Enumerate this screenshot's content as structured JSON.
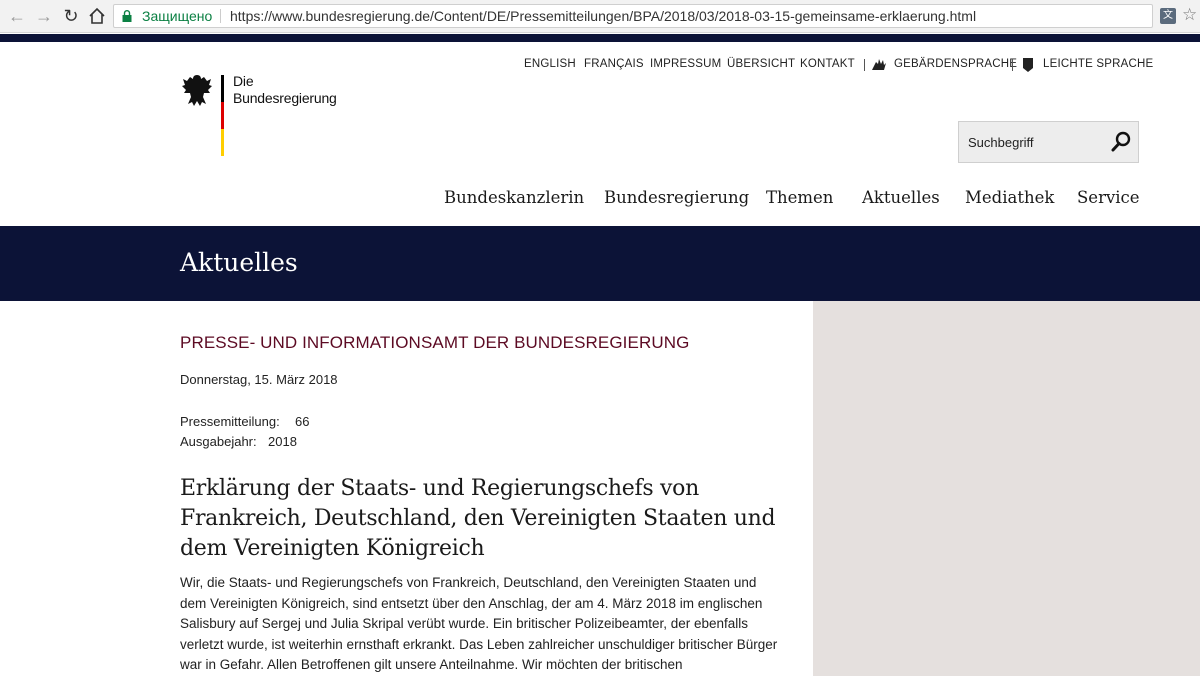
{
  "browser": {
    "secure_label": "Защищено",
    "url": "https://www.bundesregierung.de/Content/DE/Pressemitteilungen/BPA/2018/03/2018-03-15-gemeinsame-erklaerung.html",
    "icons": [
      "back-icon",
      "forward-icon",
      "reload-icon",
      "home-icon",
      "lock-icon",
      "translate-icon",
      "star-icon"
    ]
  },
  "logo": {
    "line1": "Die",
    "line2": "Bundesregierung"
  },
  "meta_nav": {
    "english": "ENGLISH",
    "francais": "FRANÇAIS",
    "impressum": "IMPRESSUM",
    "uebersicht": "ÜBERSICHT",
    "kontakt": "KONTAKT",
    "gebaerdensprache": "GEBÄRDENSPRACHE",
    "leichte_sprache": "LEICHTE SPRACHE"
  },
  "search": {
    "placeholder": "Suchbegriff"
  },
  "main_nav": {
    "bundeskanzlerin": "Bundeskanzlerin",
    "bundesregierung": "Bundesregierung",
    "themen": "Themen",
    "aktuelles": "Aktuelles",
    "mediathek": "Mediathek",
    "service": "Service"
  },
  "banner": {
    "title": "Aktuelles"
  },
  "article": {
    "org": "PRESSE- UND INFORMATIONSAMT DER BUNDESREGIERUNG",
    "date": "Donnerstag, 15. März 2018",
    "pm_label": "Pressemitteilung:",
    "pm_value": "66",
    "year_label": "Ausgabejahr:",
    "year_value": "2018",
    "headline": "Erklärung der Staats- und Regierungschefs von Frankreich, Deutschland, den Vereinigten Staaten und dem Vereinigten Königreich",
    "body": "Wir, die Staats- und Regierungschefs von Frankreich, Deutschland, den Vereinigten Staaten und dem Vereinigten Königreich, sind entsetzt über den Anschlag, der am 4. März 2018 im englischen Salisbury auf Sergej und Julia Skripal verübt wurde. Ein britischer Polizeibeamter, der ebenfalls verletzt wurde, ist weiterhin ernsthaft erkrankt. Das Leben zahlreicher unschuldiger britischer Bürger war in Gefahr. Allen Betroffenen gilt unsere Anteilnahme. Wir möchten der britischen"
  },
  "colors": {
    "navy": "#0c1337",
    "org_red": "#5c0a23",
    "sidebar": "#e5e0de"
  }
}
